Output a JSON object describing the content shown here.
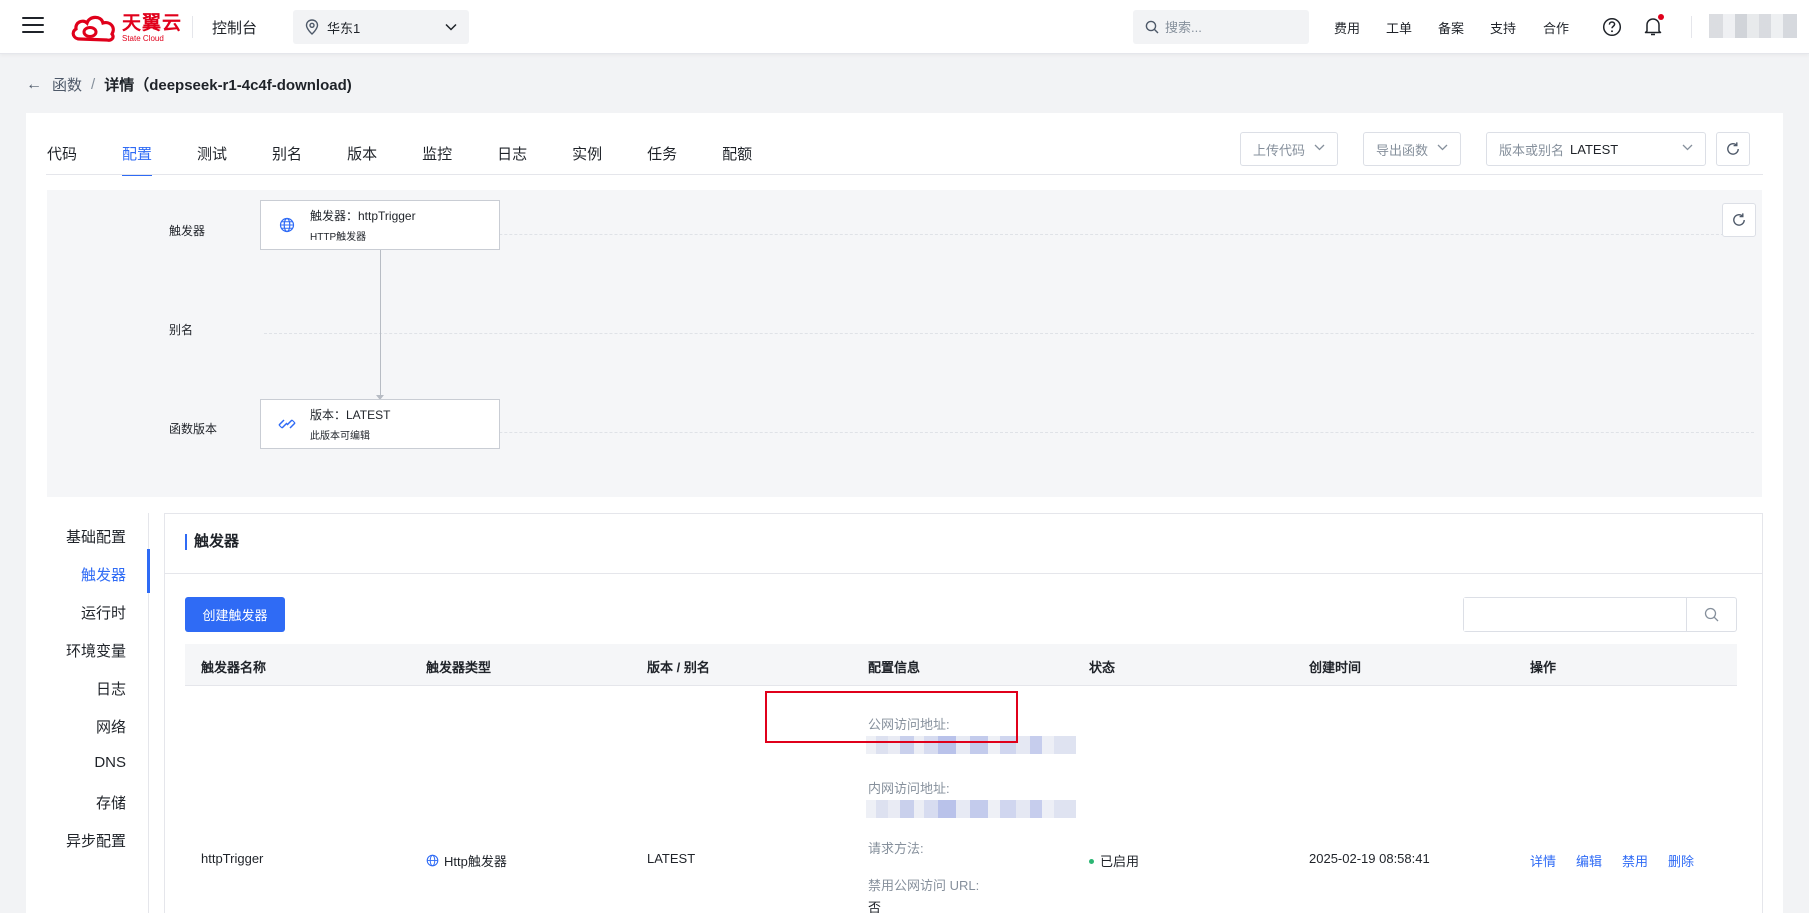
{
  "header": {
    "logo_cn": "天翼云",
    "logo_en": "State Cloud",
    "console": "控制台",
    "region": "华东1",
    "search_placeholder": "搜索...",
    "nav": [
      "费用",
      "工单",
      "备案",
      "支持",
      "合作"
    ]
  },
  "breadcrumb": {
    "parent": "函数",
    "separator": "/",
    "current": "详情（deepseek-r1-4c4f-download)"
  },
  "tabs": [
    "代码",
    "配置",
    "测试",
    "别名",
    "版本",
    "监控",
    "日志",
    "实例",
    "任务",
    "配额"
  ],
  "active_tab": "配置",
  "toolbar": {
    "upload_code": "上传代码",
    "export_function": "导出函数",
    "version_label": "版本或别名",
    "version_value": "LATEST"
  },
  "diagram": {
    "row_trigger": "触发器",
    "row_alias": "别名",
    "row_version": "函数版本",
    "trigger_node_title": "触发器：httpTrigger",
    "trigger_node_sub": "HTTP触发器",
    "version_node_title": "版本：LATEST",
    "version_node_sub": "此版本可编辑"
  },
  "subnav": [
    "基础配置",
    "触发器",
    "运行时",
    "环境变量",
    "日志",
    "网络",
    "DNS",
    "存储",
    "异步配置"
  ],
  "active_subnav": "触发器",
  "panel": {
    "title": "触发器",
    "create_button": "创建触发器",
    "columns": [
      "触发器名称",
      "触发器类型",
      "版本 / 别名",
      "配置信息",
      "状态",
      "创建时间",
      "操作"
    ],
    "row": {
      "name": "httpTrigger",
      "type": "Http触发器",
      "version": "LATEST",
      "public_url_label": "公网访问地址:",
      "private_url_label": "内网访问地址:",
      "method_label": "请求方法:",
      "disable_public_label": "禁用公网访问 URL:",
      "disable_public_value": "否",
      "status": "已启用",
      "created": "2025-02-19 08:58:41",
      "actions": [
        "详情",
        "编辑",
        "禁用",
        "删除"
      ]
    }
  },
  "colors": {
    "brand": "#e0001b",
    "accent": "#2f6bf5",
    "status_ok": "#2bb673"
  }
}
